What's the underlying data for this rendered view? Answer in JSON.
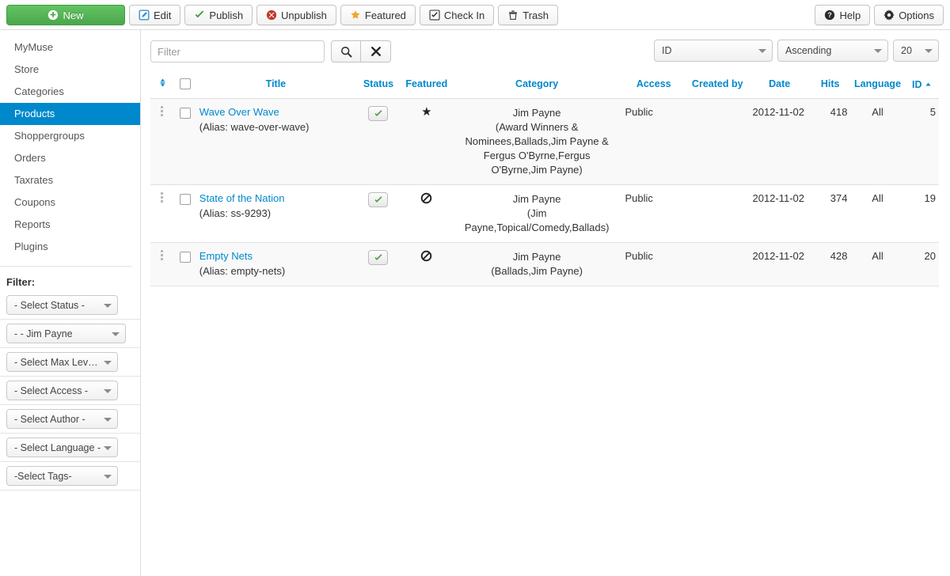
{
  "toolbar": {
    "left_buttons": [
      {
        "label": "New",
        "icon": "plus-circle-icon",
        "style": "primary"
      },
      {
        "label": "Edit",
        "icon": "pencil-square-icon",
        "style": "default"
      },
      {
        "label": "Publish",
        "icon": "check-icon",
        "style": "default"
      },
      {
        "label": "Unpublish",
        "icon": "times-circle-icon",
        "style": "default"
      },
      {
        "label": "Featured",
        "icon": "star-icon",
        "style": "default"
      },
      {
        "label": "Check In",
        "icon": "checkbox-icon",
        "style": "default"
      },
      {
        "label": "Trash",
        "icon": "trash-icon",
        "style": "default"
      }
    ],
    "right_buttons": [
      {
        "label": "Help",
        "icon": "question-circle-icon"
      },
      {
        "label": "Options",
        "icon": "gear-icon"
      }
    ]
  },
  "sidebar": {
    "nav_items": [
      {
        "label": "MyMuse",
        "active": false
      },
      {
        "label": "Store",
        "active": false
      },
      {
        "label": "Categories",
        "active": false
      },
      {
        "label": "Products",
        "active": true
      },
      {
        "label": "Shoppergroups",
        "active": false
      },
      {
        "label": "Orders",
        "active": false
      },
      {
        "label": "Taxrates",
        "active": false
      },
      {
        "label": "Coupons",
        "active": false
      },
      {
        "label": "Reports",
        "active": false
      },
      {
        "label": "Plugins",
        "active": false
      }
    ],
    "filter_heading": "Filter:",
    "filters": [
      {
        "name": "status",
        "value": "- Select Status -"
      },
      {
        "name": "category",
        "value": "- - Jim Payne"
      },
      {
        "name": "max-levels",
        "value": "- Select Max Lev…"
      },
      {
        "name": "access",
        "value": "- Select Access -"
      },
      {
        "name": "author",
        "value": "- Select Author -"
      },
      {
        "name": "language",
        "value": "- Select Language -"
      },
      {
        "name": "tags",
        "value": "-Select Tags-"
      }
    ]
  },
  "search": {
    "placeholder": "Filter",
    "value": "",
    "search_icon": "magnifier-icon",
    "clear_icon": "x-icon",
    "sort_by": "ID",
    "sort_direction": "Ascending",
    "list_limit": "20"
  },
  "table": {
    "columns": [
      {
        "key": "ordering",
        "label": "",
        "icon": "sort-updown-icon"
      },
      {
        "key": "checkall",
        "label": "",
        "icon": "checkbox-icon"
      },
      {
        "key": "title",
        "label": "Title"
      },
      {
        "key": "status",
        "label": "Status"
      },
      {
        "key": "featured",
        "label": "Featured"
      },
      {
        "key": "category",
        "label": "Category"
      },
      {
        "key": "access",
        "label": "Access"
      },
      {
        "key": "created_by",
        "label": "Created by"
      },
      {
        "key": "date",
        "label": "Date"
      },
      {
        "key": "hits",
        "label": "Hits"
      },
      {
        "key": "language",
        "label": "Language"
      },
      {
        "key": "id",
        "label": "ID",
        "sorted": "ascending"
      }
    ],
    "rows": [
      {
        "title": "Wave Over Wave",
        "alias": "(Alias: wave-over-wave)",
        "status": "published",
        "featured": "featured",
        "category_main": "Jim Payne",
        "category_detail": "(Award Winners & Nominees,Ballads,Jim Payne & Fergus O'Byrne,Fergus O'Byrne,Jim Payne)",
        "access": "Public",
        "created_by": "",
        "date": "2012-11-02",
        "hits": "418",
        "language": "All",
        "id": "5"
      },
      {
        "title": "State of the Nation",
        "alias": "(Alias: ss-9293)",
        "status": "published",
        "featured": "unfeatured",
        "category_main": "Jim Payne",
        "category_detail": "(Jim Payne,Topical/Comedy,Ballads)",
        "access": "Public",
        "created_by": "",
        "date": "2012-11-02",
        "hits": "374",
        "language": "All",
        "id": "19"
      },
      {
        "title": "Empty Nets",
        "alias": "(Alias: empty-nets)",
        "status": "published",
        "featured": "unfeatured",
        "category_main": "Jim Payne",
        "category_detail": "(Ballads,Jim Payne)",
        "access": "Public",
        "created_by": "",
        "date": "2012-11-02",
        "hits": "428",
        "language": "All",
        "id": "20"
      }
    ]
  },
  "colors": {
    "accent_blue": "#0088cc",
    "primary_green": "#4ca64c",
    "check_green": "#4a9f3f",
    "star_dark": "#222222",
    "row_alt": "#f9f9f9"
  }
}
